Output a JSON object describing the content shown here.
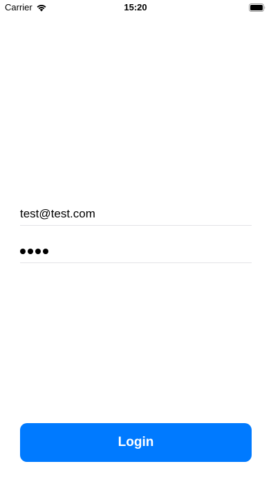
{
  "status_bar": {
    "carrier": "Carrier",
    "time": "15:20",
    "wifi_icon": "wifi-icon",
    "battery_icon": "battery-icon"
  },
  "form": {
    "email_value": "test@test.com",
    "password_dot_count": 4
  },
  "login_button": {
    "label": "Login"
  },
  "colors": {
    "accent": "#007aff",
    "separator": "#e3e3e6"
  }
}
